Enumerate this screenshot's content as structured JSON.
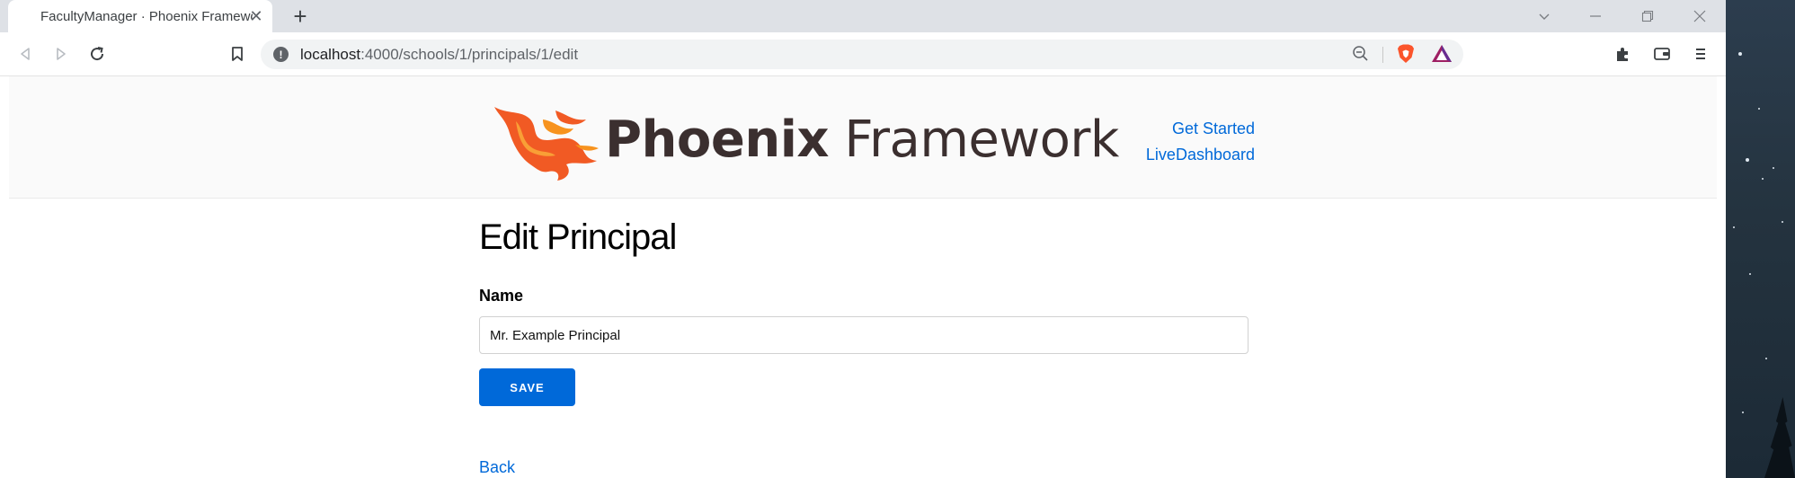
{
  "browser": {
    "tab_title": "FacultyManager · Phoenix Framework",
    "tab_close_glyph": "✕",
    "new_tab_glyph": "+",
    "url_host": "localhost",
    "url_path": ":4000/schools/1/principals/1/edit",
    "icons": [
      "back-icon",
      "forward-icon",
      "reload-icon",
      "bookmark-icon",
      "site-info-icon",
      "zoom-out-icon",
      "brave-shields-icon",
      "brave-rewards-icon",
      "extensions-icon",
      "wallet-icon",
      "menu-icon",
      "chevron-down-icon",
      "minimize-icon",
      "restore-icon",
      "close-icon"
    ]
  },
  "header": {
    "logo_bold": "Phoenix",
    "logo_light": " Framework",
    "nav": [
      "Get Started",
      "LiveDashboard"
    ]
  },
  "main": {
    "title": "Edit Principal",
    "name_label": "Name",
    "name_value": "Mr. Example Principal",
    "save_label": "SAVE",
    "back_label": "Back"
  },
  "colors": {
    "link": "#0069d9",
    "button": "#0069d9",
    "logo_orange": "#f15a24",
    "logo_text": "#3b2f2f"
  }
}
